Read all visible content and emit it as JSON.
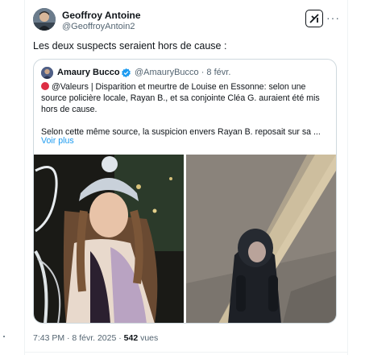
{
  "tweet": {
    "author_name": "Geoffroy Antoine",
    "author_handle": "@GeoffroyAntoin2",
    "text": "Les deux suspects seraient hors de cause :",
    "grok_icon": "grok-icon",
    "more_icon": "more-icon",
    "more_label": "···",
    "time": "7:43 PM · 8 févr. 2025 · ",
    "views_count": "542",
    "views_label": " vues"
  },
  "quote": {
    "author_name": "Amaury Bucco",
    "author_handle": "@AmauryBucco · 8 févr.",
    "verified_icon": "verified-badge-icon",
    "line1": "@Valeurs | Disparition et meurtre de Louise en Essonne: selon une source policière locale, Rayan B., et sa conjointe Cléa G. auraient été mis hors de cause.",
    "line2": "Selon cette même source, la suspicion envers Rayan B. reposait sur sa ...",
    "more_link": "Voir plus",
    "accent_color": "#1d9bf0",
    "dot_color": "#dd2e44"
  }
}
